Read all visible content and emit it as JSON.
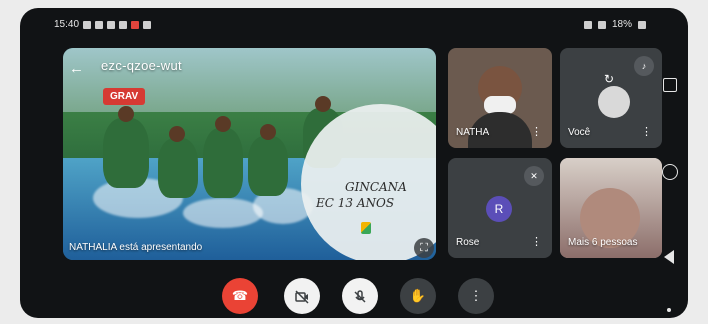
{
  "status_bar": {
    "time": "15:40",
    "right_text": "18%"
  },
  "meeting": {
    "code": "ezc-qzoe-wut",
    "recording_badge": "GRAV",
    "presenting_text": "NATHALIA está apresentando",
    "slide_title": "GINCANA",
    "slide_subtitle": "EC 13 ANOS"
  },
  "participants": [
    {
      "name": "NATHA",
      "type": "video"
    },
    {
      "name": "Você",
      "type": "video"
    },
    {
      "name": "Rose",
      "initial": "R",
      "type": "avatar",
      "avatar_color": "#5b4eb8"
    },
    {
      "name": "Mais 6 pessoas",
      "type": "more"
    }
  ],
  "controls": {
    "end_call": "end-call-icon",
    "camera": "camera-off-icon",
    "mic": "mic-off-icon",
    "hand": "raise-hand-icon",
    "more": "more-options-icon"
  },
  "icons": {
    "back": "←",
    "fullscreen": "⛶",
    "more_vert": "⋮",
    "muted": "✕",
    "volume": "♪",
    "switch_camera": "↻",
    "end": "☎",
    "hand": "✋"
  },
  "colors": {
    "end_call": "#ea4335",
    "recording": "#d63a33",
    "avatar_rose": "#5b4eb8"
  }
}
